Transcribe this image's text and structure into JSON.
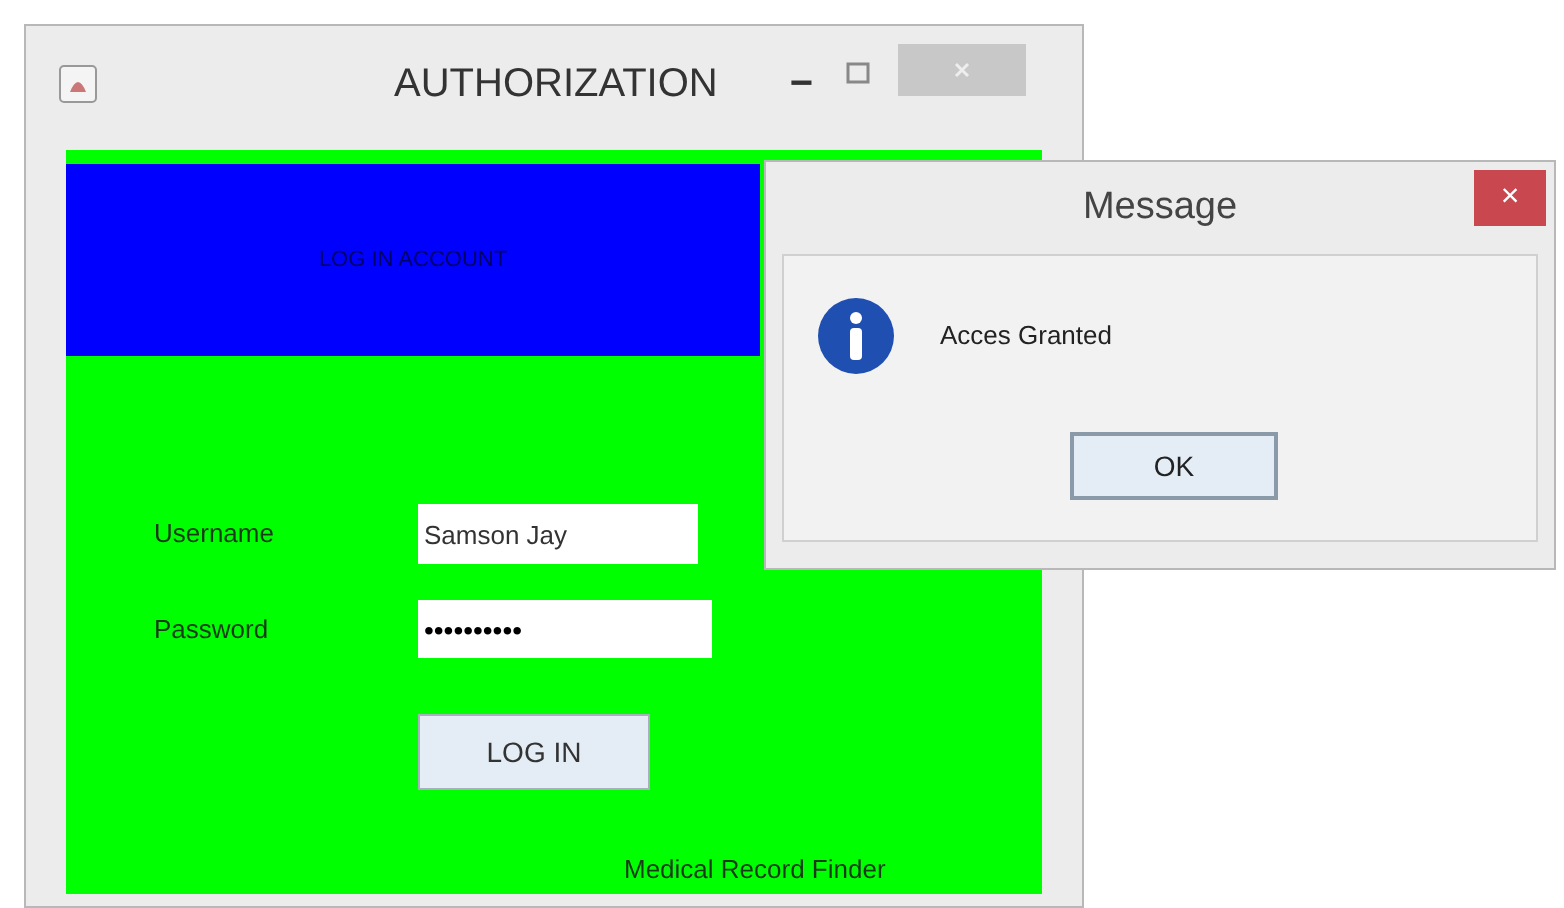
{
  "main_window": {
    "title": "AUTHORIZATION",
    "minimize": "−",
    "header": "LOG IN ACCOUNT",
    "username_label": "Username",
    "username_value": "Samson Jay",
    "password_label": "Password",
    "password_value": "••••••••••",
    "login_button": "LOG IN",
    "footer": "Medical Record Finder"
  },
  "dialog": {
    "title": "Message",
    "close": "×",
    "message": "Acces Granted",
    "ok_button": "OK"
  }
}
